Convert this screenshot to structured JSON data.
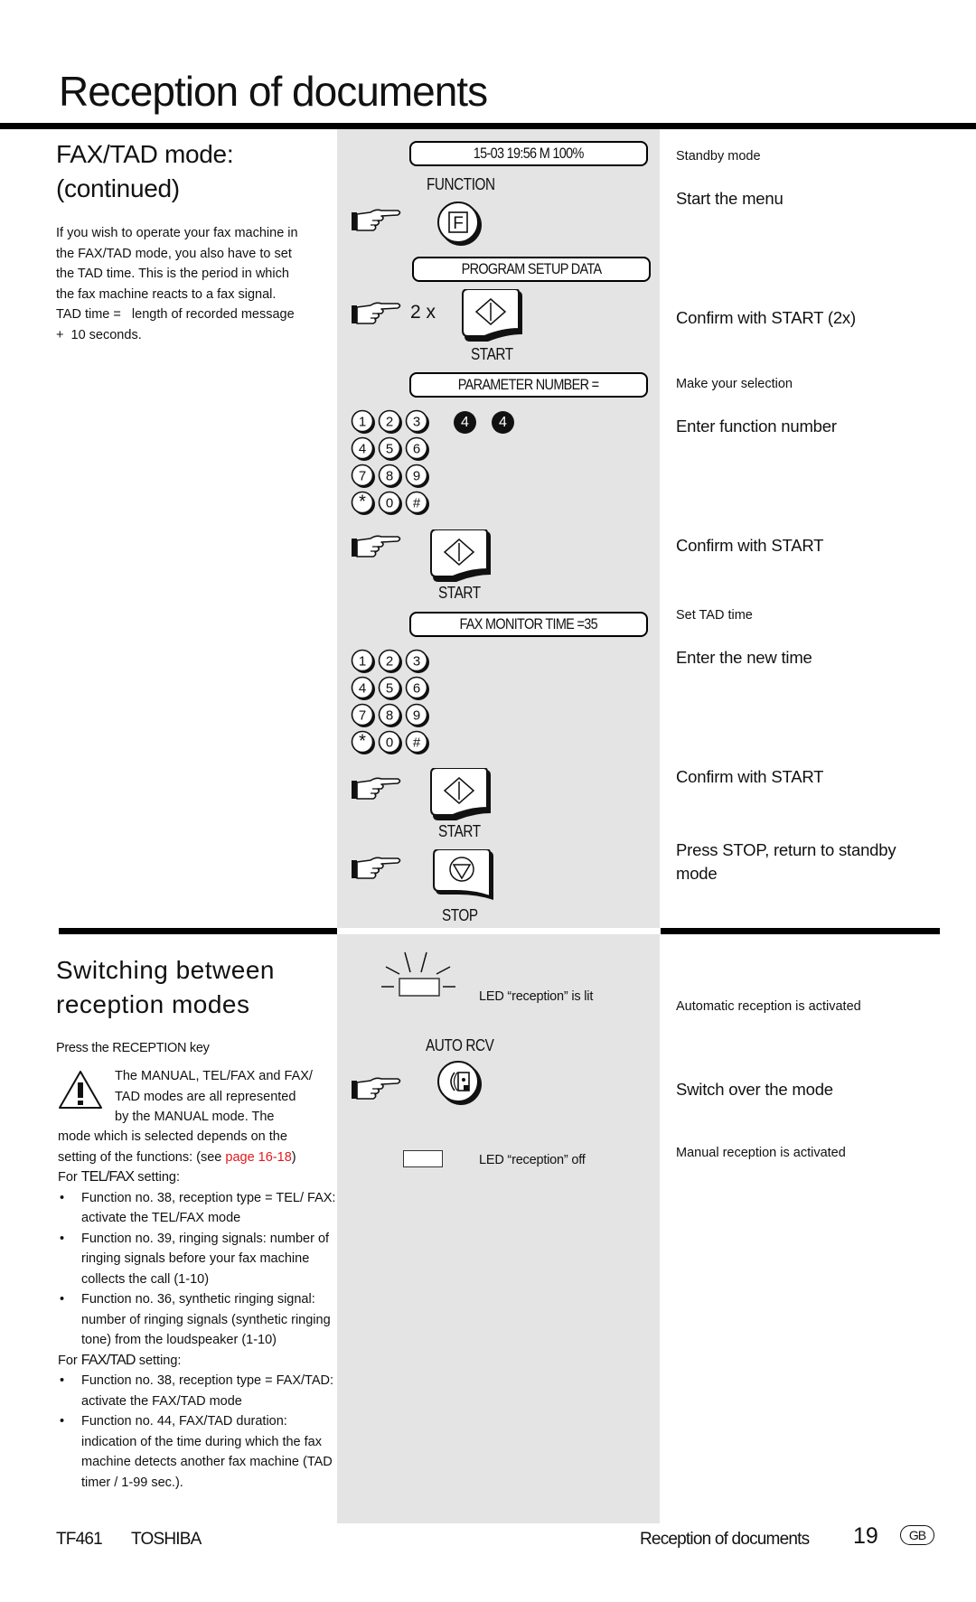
{
  "page": {
    "title": "Reception of documents"
  },
  "section1": {
    "title_line1": "FAX/TAD mode:",
    "title_line2": "(continued)",
    "intro": [
      "If you wish to operate your fax machine in",
      "the FAX/TAD mode, you also have to set",
      "the TAD time. This is the period in which",
      "the fax machine reacts to a fax signal.",
      "TAD time =   length of recorded message",
      "+  10 seconds."
    ],
    "steps": {
      "display_standby": "15-03 19:56  M 100%",
      "function_label": "FUNCTION",
      "function_key_glyph": "F",
      "display_program": "PROGRAM SETUP DATA",
      "press_count": "2 x",
      "start_label": "START",
      "display_parameter": "PARAMETER NUMBER =",
      "entered_digits": [
        "4",
        "4"
      ],
      "display_monitor": "FAX MONITOR TIME =35",
      "stop_label": "STOP"
    },
    "keypad_keys": [
      "1",
      "2",
      "3",
      "4",
      "5",
      "6",
      "7",
      "8",
      "9",
      "*",
      "0",
      "#"
    ],
    "instructions": {
      "standby": "Standby mode",
      "start_menu": "Start the menu",
      "confirm_2x": "Confirm with START (2x)",
      "make_selection": "Make your selection",
      "enter_function": "Enter function number",
      "confirm_1": "Confirm with START",
      "set_tad": "Set TAD time",
      "enter_time": "Enter the new time",
      "confirm_2": "Confirm with START",
      "press_stop_line1": "Press STOP, return to standby",
      "press_stop_line2": "mode"
    }
  },
  "section2": {
    "title_line1": "Switching between",
    "title_line2": "reception modes",
    "press_key": "Press the RECEPTION key",
    "warning_lines": [
      "The MANUAL, TEL/FAX and FAX/",
      "TAD modes are all represented",
      "by the MANUAL mode. The"
    ],
    "warning_cont": "mode which is selected depends on the",
    "setting_prefix": "setting of the functions: (see ",
    "setting_link": "page 16-18",
    "setting_suffix": ")",
    "telfax_heading_prefix": "For ",
    "telfax_heading_mode": "TEL/FAX",
    "telfax_heading_suffix": " setting:",
    "telfax_bullets": [
      "Function no. 38, reception type = TEL/ FAX: activate the TEL/FAX mode",
      "Function no. 39, ringing signals: number of ringing signals before your fax machine collects the call (1-10)",
      "Function no. 36, synthetic ringing signal: number of ringing signals (synthetic ringing tone) from the loudspeaker (1-10)"
    ],
    "faxtad_heading_prefix": "For ",
    "faxtad_heading_mode": "FAX/TAD",
    "faxtad_heading_suffix": " setting:",
    "faxtad_bullets": [
      "Function no. 38, reception type = FAX/TAD: activate the FAX/TAD mode",
      "Function no. 44, FAX/TAD duration: indication of the time during which the fax machine detects another fax machine (TAD timer / 1-99 sec.)."
    ],
    "led_lit": "LED “reception” is lit",
    "auto_rcv_label": "AUTO RCV",
    "led_off": "LED “reception” off",
    "instructions": {
      "auto_activated": "Automatic reception is activated",
      "switch_mode": "Switch over the mode",
      "manual_activated": "Manual reception is activated"
    }
  },
  "footer": {
    "model": "TF461",
    "brand": "TOSHIBA",
    "section": "Reception of documents",
    "page_number": "19",
    "country_badge": "GB"
  },
  "colors": {
    "panel_gray": "#e4e4e4",
    "link_red": "#e3191b",
    "rule_black": "#000000"
  }
}
